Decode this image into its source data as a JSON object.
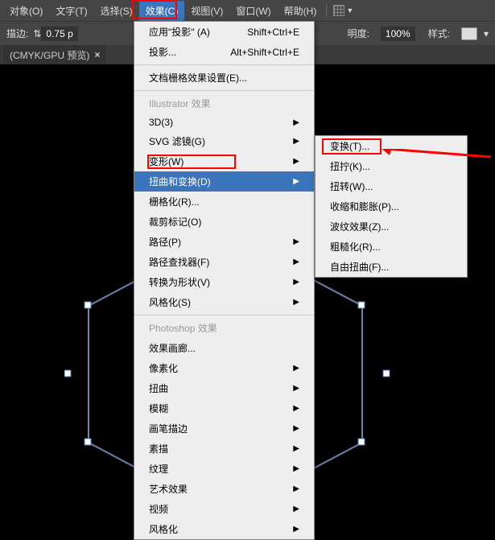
{
  "menubar": {
    "items": [
      "对象(O)",
      "文字(T)",
      "选择(S)",
      "效果(C)",
      "视图(V)",
      "窗口(W)",
      "帮助(H)"
    ],
    "active_index": 3
  },
  "toolbar": {
    "stroke_label": "描边:",
    "stroke_val": "0.75 p",
    "opacity_label": "明度:",
    "opacity_val": "100%",
    "style_label": "样式:"
  },
  "tab": {
    "title": "(CMYK/GPU 预览)"
  },
  "menu": {
    "top": [
      {
        "label": "应用\"投影\" (A)",
        "shortcut": "Shift+Ctrl+E"
      },
      {
        "label": "投影...",
        "shortcut": "Alt+Shift+Ctrl+E"
      }
    ],
    "doc_raster": "文档栅格效果设置(E)...",
    "illustrator_header": "Illustrator 效果",
    "illustrator": [
      {
        "label": "3D(3)",
        "arrow": true
      },
      {
        "label": "SVG 滤镜(G)",
        "arrow": true
      },
      {
        "label": "变形(W)",
        "arrow": true
      },
      {
        "label": "扭曲和变换(D)",
        "arrow": true,
        "hl": true
      },
      {
        "label": "栅格化(R)..."
      },
      {
        "label": "裁剪标记(O)"
      },
      {
        "label": "路径(P)",
        "arrow": true
      },
      {
        "label": "路径查找器(F)",
        "arrow": true
      },
      {
        "label": "转换为形状(V)",
        "arrow": true
      },
      {
        "label": "风格化(S)",
        "arrow": true
      }
    ],
    "photoshop_header": "Photoshop 效果",
    "photoshop": [
      {
        "label": "效果画廊..."
      },
      {
        "label": "像素化",
        "arrow": true
      },
      {
        "label": "扭曲",
        "arrow": true
      },
      {
        "label": "模糊",
        "arrow": true
      },
      {
        "label": "画笔描边",
        "arrow": true
      },
      {
        "label": "素描",
        "arrow": true
      },
      {
        "label": "纹理",
        "arrow": true
      },
      {
        "label": "艺术效果",
        "arrow": true
      },
      {
        "label": "视频",
        "arrow": true
      },
      {
        "label": "风格化",
        "arrow": true
      }
    ]
  },
  "submenu": {
    "items": [
      "变换(T)...",
      "扭拧(K)...",
      "扭转(W)...",
      "收缩和膨胀(P)...",
      "波纹效果(Z)...",
      "粗糙化(R)...",
      "自由扭曲(F)..."
    ]
  }
}
